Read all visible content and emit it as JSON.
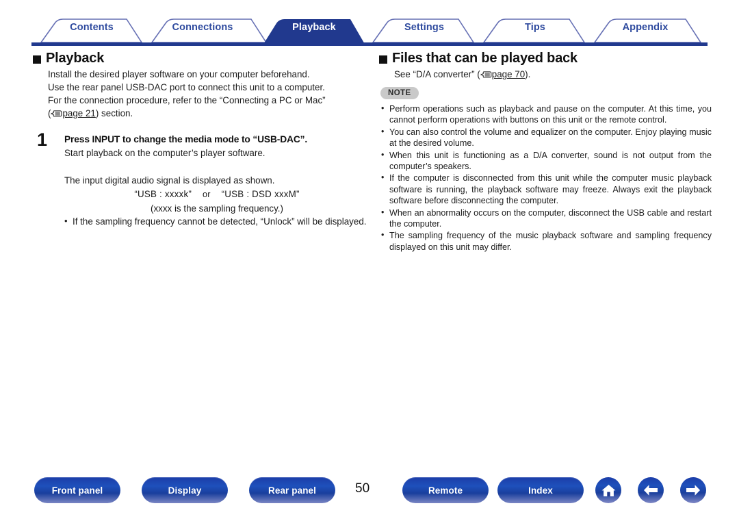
{
  "tabs": [
    {
      "label": "Contents",
      "active": false
    },
    {
      "label": "Connections",
      "active": false
    },
    {
      "label": "Playback",
      "active": true
    },
    {
      "label": "Settings",
      "active": false
    },
    {
      "label": "Tips",
      "active": false
    },
    {
      "label": "Appendix",
      "active": false
    }
  ],
  "left": {
    "heading": "Playback",
    "intro_lines": [
      "Install the desired player software on your computer beforehand.",
      "Use the rear panel USB-DAC port to connect this unit to a computer.",
      "For the connection procedure, refer to the “Connecting a PC or Mac”"
    ],
    "intro_ref_open": "(",
    "intro_ref_link": "page 21",
    "intro_ref_close": ") section.",
    "step_number": "1",
    "step_title": "Press INPUT to change the media mode to “USB-DAC”.",
    "step_sub": "Start playback on the computer’s player software.",
    "signal_line": "The input digital audio signal is displayed as shown.",
    "usb_option_1": "“USB : xxxxk”",
    "usb_or": "or",
    "usb_option_2": "“USB : DSD xxxM”",
    "freq_note": "(xxxx is the sampling frequency.)",
    "bullets": [
      "If the sampling frequency cannot be detected, “Unlock” will be displayed."
    ]
  },
  "right": {
    "heading": "Files that can be played back",
    "see_prefix": "See “D/A converter” (",
    "see_link": "page 70",
    "see_suffix": ").",
    "note_badge": "NOTE",
    "notes": [
      "Perform operations such as playback and pause on the computer. At this time, you cannot perform operations with buttons on this unit or the remote control.",
      "You can also control the volume and equalizer on the computer. Enjoy playing music at the desired volume.",
      "When this unit is functioning as a D/A converter, sound is not output from the computer’s speakers.",
      "If the computer is disconnected from this unit while the computer music playback software is running, the playback software may freeze. Always exit the playback software before disconnecting the computer.",
      "When an abnormality occurs on the computer, disconnect the USB cable and restart the computer.",
      "The sampling frequency of the music playback software and sampling frequency displayed on this unit may differ."
    ]
  },
  "footer": {
    "buttons": [
      {
        "label": "Front panel"
      },
      {
        "label": "Display"
      },
      {
        "label": "Rear panel"
      },
      {
        "label": "Remote"
      },
      {
        "label": "Index"
      }
    ],
    "page_number": "50",
    "icons": [
      {
        "name": "home-icon"
      },
      {
        "name": "arrow-left-icon"
      },
      {
        "name": "arrow-right-icon"
      }
    ]
  },
  "colors": {
    "tab_active_bg": "#21398e",
    "tab_text": "#2e4a9e",
    "tab_outline": "#6670b4",
    "rule": "#21398e",
    "button_blue": "#1c3da8",
    "note_badge_bg": "#c9c9c9"
  }
}
